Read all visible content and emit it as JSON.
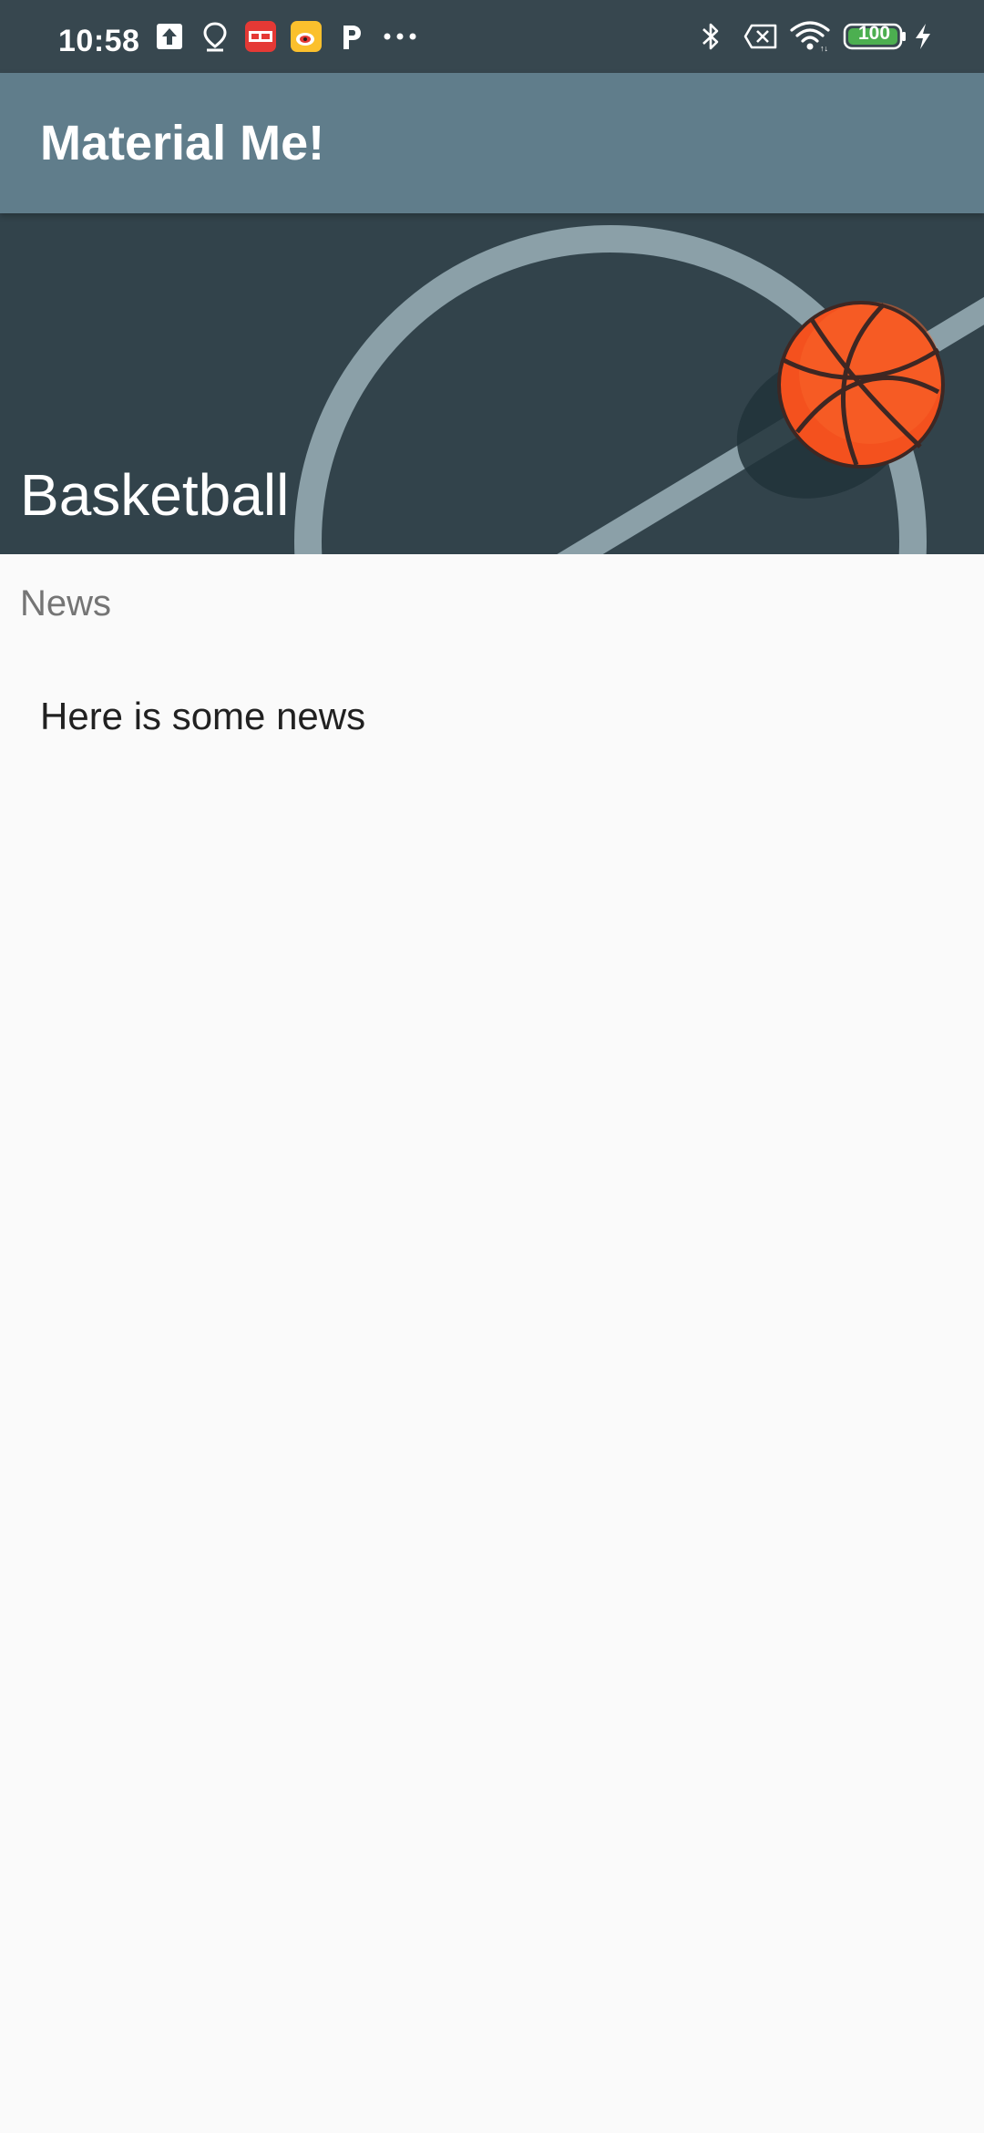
{
  "status_bar": {
    "time": "10:58",
    "battery_level": "100",
    "left_icons": [
      "upload-icon",
      "location-pin-icon",
      "toutiao-app-icon",
      "weibo-app-icon",
      "p-app-icon",
      "more-dots-icon"
    ],
    "right_icons": [
      "bluetooth-icon",
      "no-sim-icon",
      "wifi-icon",
      "battery-icon",
      "charging-bolt-icon"
    ],
    "colors": {
      "background": "#37474f",
      "battery_fill": "#4caf50"
    }
  },
  "app_bar": {
    "title": "Material Me!",
    "background": "#607d8b"
  },
  "hero": {
    "title": "Basketball",
    "image": "basketball-court-illustration",
    "background": "#32434b"
  },
  "content": {
    "subheading": "News",
    "body": "Here is some news"
  }
}
